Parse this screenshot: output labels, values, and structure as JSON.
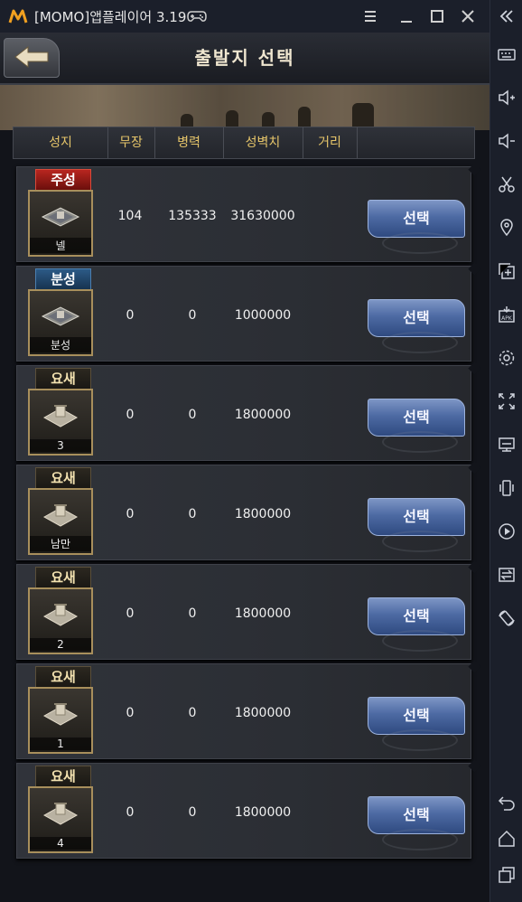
{
  "window": {
    "app_title": "[MOMO]앱플레이어 3.19",
    "controls": [
      "menu-icon",
      "minimize-icon",
      "maximize-icon",
      "close-icon"
    ]
  },
  "sidebar": {
    "top_icon": "double-chevron-left-icon",
    "items": [
      "keyboard-icon",
      "volume-up-icon",
      "volume-down-icon",
      "scissors-icon",
      "location-icon",
      "add-window-icon",
      "apk-icon",
      "settings-icon",
      "fullscreen-icon",
      "screen-icon",
      "shake-icon",
      "record-icon",
      "sync-icon",
      "rotate-icon"
    ],
    "bottom": [
      "back-icon",
      "home-icon",
      "recent-apps-icon"
    ]
  },
  "header": {
    "title": "출발지 선택"
  },
  "columns": [
    "성지",
    "무장",
    "병력",
    "성벽치",
    "거리"
  ],
  "rows": [
    {
      "type": "주성",
      "type_style": "red",
      "name": "넬",
      "generals": "104",
      "troops": "135333",
      "wall": "31630000",
      "button": "선택"
    },
    {
      "type": "분성",
      "type_style": "blue",
      "name": "분성",
      "generals": "0",
      "troops": "0",
      "wall": "1000000",
      "button": "선택"
    },
    {
      "type": "요새",
      "type_style": "plain",
      "name": "3",
      "generals": "0",
      "troops": "0",
      "wall": "1800000",
      "button": "선택"
    },
    {
      "type": "요새",
      "type_style": "plain",
      "name": "남만",
      "generals": "0",
      "troops": "0",
      "wall": "1800000",
      "button": "선택"
    },
    {
      "type": "요새",
      "type_style": "plain",
      "name": "2",
      "generals": "0",
      "troops": "0",
      "wall": "1800000",
      "button": "선택"
    },
    {
      "type": "요새",
      "type_style": "plain",
      "name": "1",
      "generals": "0",
      "troops": "0",
      "wall": "1800000",
      "button": "선택"
    },
    {
      "type": "요새",
      "type_style": "plain",
      "name": "4",
      "generals": "0",
      "troops": "0",
      "wall": "1800000",
      "button": "선택"
    }
  ]
}
